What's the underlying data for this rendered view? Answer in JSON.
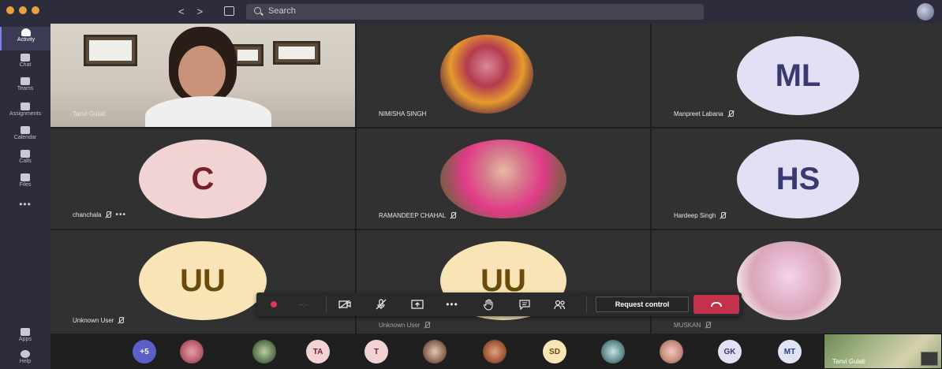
{
  "search": {
    "placeholder": "Search"
  },
  "nav": {
    "back": "<",
    "forward": ">"
  },
  "rail": {
    "items": [
      {
        "label": "Activity",
        "icon": "bell-icon",
        "active": true
      },
      {
        "label": "Chat",
        "icon": "chat-icon"
      },
      {
        "label": "Teams",
        "icon": "teams-icon"
      },
      {
        "label": "Assignments",
        "icon": "assignments-icon"
      },
      {
        "label": "Calendar",
        "icon": "calendar-icon"
      },
      {
        "label": "Calls",
        "icon": "phone-icon"
      },
      {
        "label": "Files",
        "icon": "file-icon"
      }
    ],
    "more": "•••",
    "apps_label": "Apps",
    "help_label": "Help"
  },
  "tiles": [
    {
      "name": "Tanvi Gulati",
      "type": "video"
    },
    {
      "name": "NIMISHA SINGH",
      "type": "photo"
    },
    {
      "name": "Manpreet Labana",
      "type": "initials",
      "initials": "ML",
      "muted": true,
      "bg": "#e3e0f5",
      "fg": "#3b3a70"
    },
    {
      "name": "chanchala",
      "type": "initials",
      "initials": "C",
      "muted": true,
      "bg": "#f2d3d4",
      "fg": "#7a1f2b",
      "more": "•••"
    },
    {
      "name": "RAMANDEEP CHAHAL",
      "type": "photo",
      "muted": true
    },
    {
      "name": "Hardeep Singh",
      "type": "initials",
      "initials": "HS",
      "muted": true,
      "bg": "#e3e0f5",
      "fg": "#3b3a70"
    },
    {
      "name": "Unknown User",
      "type": "initials",
      "initials": "UU",
      "muted": true,
      "bg": "#f8e4b5",
      "fg": "#6b4a0a"
    },
    {
      "name": "Unknown User",
      "type": "initials",
      "initials": "UU",
      "muted": true,
      "bg": "#f8e4b5",
      "fg": "#6b4a0a"
    },
    {
      "name": "MUSKAN",
      "type": "photo",
      "muted": true
    }
  ],
  "controls": {
    "timer": "--:--",
    "more": "•••",
    "request_control": "Request control"
  },
  "strip": {
    "overflow": "+5",
    "chips": [
      {
        "type": "photo",
        "color": "#b85c6a"
      },
      {
        "type": "photo",
        "color": "#5e7a52"
      },
      {
        "type": "initials",
        "text": "TA",
        "bg": "#f2d3d4",
        "fg": "#7a1f2b"
      },
      {
        "type": "initials",
        "text": "T",
        "bg": "#f2d3d4",
        "fg": "#7a1f2b"
      },
      {
        "type": "photo",
        "color": "#8a6a55"
      },
      {
        "type": "photo",
        "color": "#a0583a"
      },
      {
        "type": "initials",
        "text": "SD",
        "bg": "#f8e4b5",
        "fg": "#6b4a0a"
      },
      {
        "type": "photo",
        "color": "#5f8a8c"
      },
      {
        "type": "photo",
        "color": "#c48a7c"
      },
      {
        "type": "photo",
        "color": "#9a4c5c"
      },
      {
        "type": "initials",
        "text": "GK",
        "bg": "#e3e0f5",
        "fg": "#3b3a70"
      },
      {
        "type": "initials",
        "text": "MT",
        "bg": "#dfe4f5",
        "fg": "#2f3f8a"
      }
    ],
    "shared_name": "Tanvi Gulati"
  },
  "colors": {
    "accent": "#7b83eb",
    "hangup": "#c4314b",
    "record": "#e0345d"
  }
}
